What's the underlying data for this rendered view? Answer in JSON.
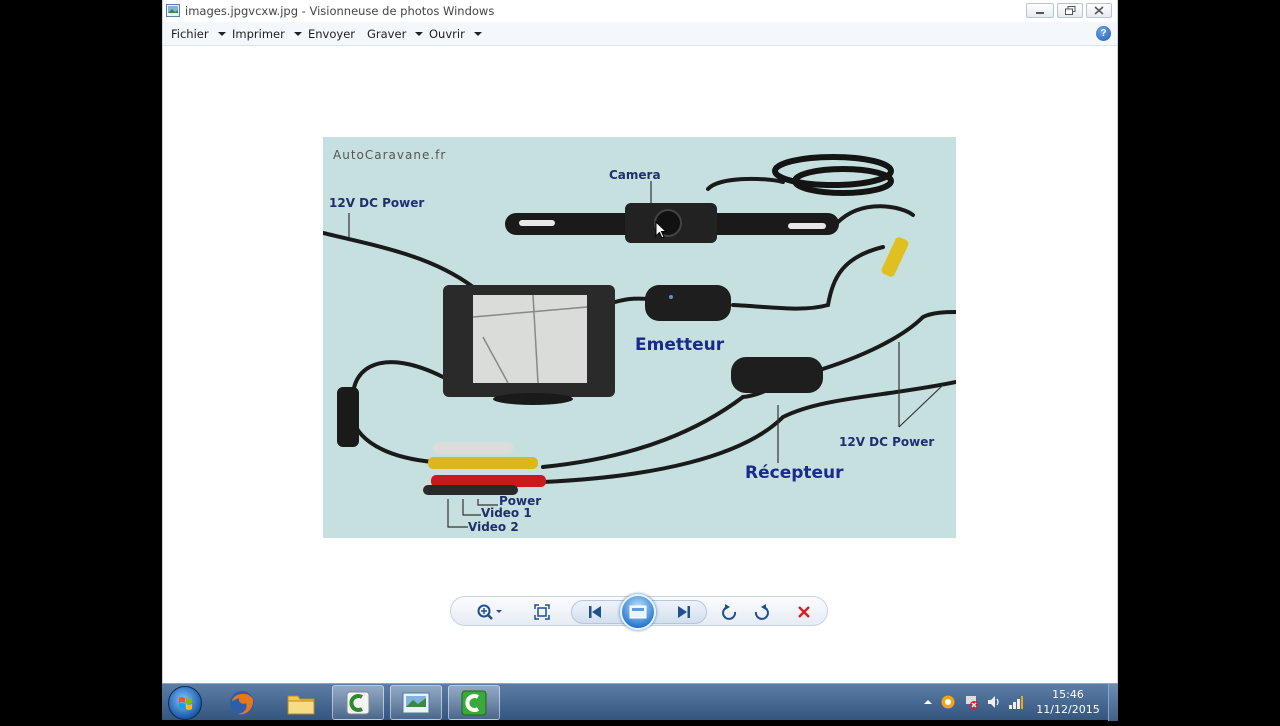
{
  "window": {
    "title": "images.jpgvcxw.jpg - Visionneuse de photos Windows"
  },
  "menu": {
    "fichier": "Fichier",
    "imprimer": "Imprimer",
    "envoyer": "Envoyer",
    "graver": "Graver",
    "ouvrir": "Ouvrir"
  },
  "photo": {
    "watermark": "AutoCaravane.fr",
    "camera": "Camera",
    "power_left": "12V DC Power",
    "emetteur": "Emetteur",
    "power_right": "12V DC Power",
    "recepteur": "Récepteur",
    "power_cable": "Power",
    "video1": "Video 1",
    "video2": "Video 2"
  },
  "controls": {
    "icons": [
      "zoom-icon",
      "fit-window-icon",
      "previous-icon",
      "slideshow-icon",
      "next-icon",
      "rotate-left-icon",
      "rotate-right-icon",
      "delete-icon"
    ]
  },
  "taskbar": {
    "time": "15:46",
    "date": "11/12/2015",
    "apps": [
      "firefox-icon",
      "file-explorer-icon",
      "camtasia-icon",
      "photo-viewer-icon",
      "camtasia-recorder-icon"
    ]
  },
  "colors": {
    "accent_blue": "#1f5cb3",
    "delete_red": "#d42020",
    "photo_bg": "#c6e0e0",
    "label_blue": "#1a2a8c"
  }
}
